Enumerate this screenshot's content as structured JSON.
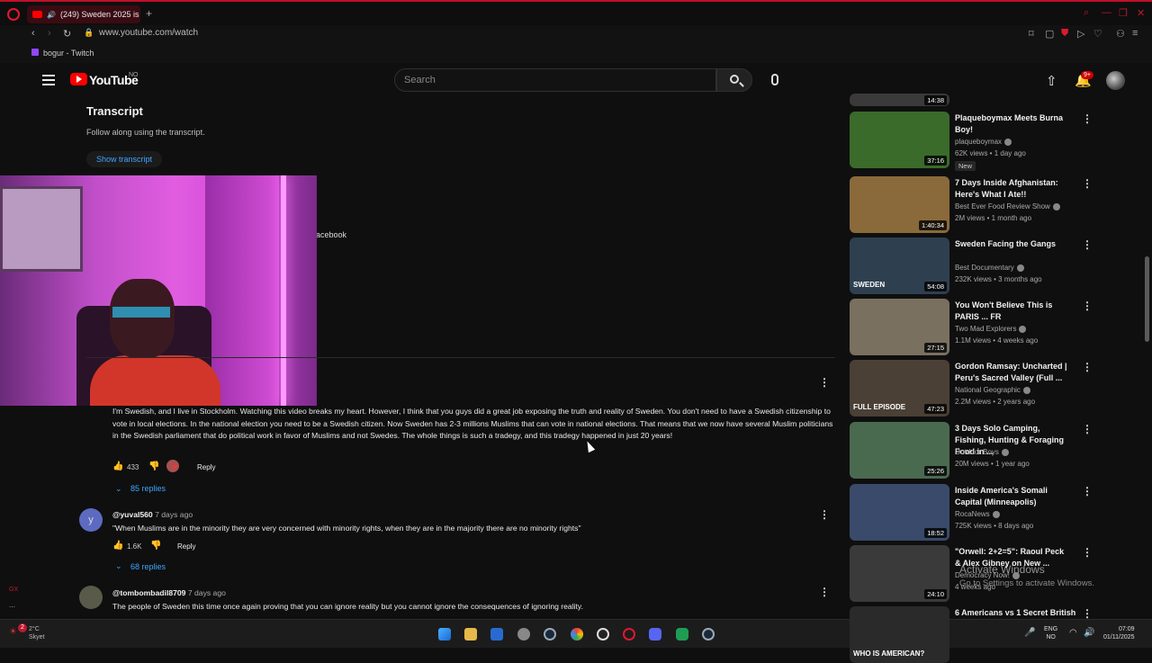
{
  "browser": {
    "tab_title": "(249) Sweden 2025 is",
    "url": "www.youtube.com/watch",
    "bookmark": "bogur - Twitch"
  },
  "youtube": {
    "wordmark": "YouTube",
    "country": "NO",
    "search_placeholder": "Search",
    "notifications": "9+"
  },
  "transcript": {
    "title": "Transcript",
    "subtitle": "Follow along using the transcript.",
    "button": "Show transcript"
  },
  "partial_text": "acebook",
  "comments": [
    {
      "text": "I'm Swedish, and I live in Stockholm. Watching this video breaks my heart. However, I think that you guys did a great job exposing the truth and reality of Sweden. You don't need to have a Swedish citizenship to vote in local elections. In the national election you need to be a Swedish citizen. Now Sweden has 2-3 millions Muslims that can vote in national elections. That means that we now have several Muslim politicians in the Swedish parliament that do political work in favor of Muslims and not Swedes. The whole things is such a tradegy, and this tradegy happened in just 20 years!",
      "likes": "433",
      "reply": "Reply",
      "replies": "85 replies"
    },
    {
      "avatar_letter": "y",
      "author": "@yuval560",
      "ago": "7 days ago",
      "text": "\"When Muslims are in the minority they are very concerned with minority rights, when they are in the majority there are no minority rights\"",
      "likes": "1.6K",
      "reply": "Reply",
      "replies": "68 replies"
    },
    {
      "author": "@tombombadil8709",
      "ago": "7 days ago",
      "text": "The people of Sweden this time once again proving that you can ignore reality but you cannot ignore the consequences of ignoring reality."
    }
  ],
  "sidebar": [
    {
      "title": "Plaqueboymax Meets Burna Boy!",
      "channel": "plaqueboymax",
      "meta": "62K views • 1 day ago",
      "badge": "New",
      "duration": "37:16",
      "color": "#3a6b2a"
    },
    {
      "title": "7 Days Inside Afghanistan: Here's What I Ate!!",
      "channel": "Best Ever Food Review Show",
      "meta": "2M views • 1 month ago",
      "duration": "1:40:34",
      "color": "#8a6a3a"
    },
    {
      "title": "Sweden Facing the Gangs",
      "channel": "Best Documentary",
      "meta": "232K views • 3 months ago",
      "duration": "54:08",
      "color": "#2e4050",
      "overlay": "SWEDEN"
    },
    {
      "title": "You Won't Believe This is PARIS ... FR",
      "channel": "Two Mad Explorers",
      "meta": "1.1M views • 4 weeks ago",
      "duration": "27:15",
      "color": "#7a7060"
    },
    {
      "title": "Gordon Ramsay: Uncharted | Peru's Sacred Valley (Full ...",
      "channel": "National Geographic",
      "meta": "2.2M views • 2 years ago",
      "duration": "47:23",
      "color": "#4a4035",
      "overlay": "FULL EPISODE"
    },
    {
      "title": "3 Days Solo Camping, Fishing, Hunting & Foraging Food in ...",
      "channel": "Outdoor Boys",
      "meta": "20M views • 1 year ago",
      "duration": "25:26",
      "color": "#4a6a50"
    },
    {
      "title": "Inside America's Somali Capital (Minneapolis)",
      "channel": "RocaNews",
      "meta": "725K views • 8 days ago",
      "duration": "18:52",
      "color": "#3a4a6a"
    },
    {
      "title": "\"Orwell: 2+2=5\": Raoul Peck & Alex Gibney on New ...",
      "channel": "Democracy Now!",
      "meta": "4 weeks ago",
      "duration": "24:10",
      "color": "#3a3a3a"
    },
    {
      "title": "6 Americans vs 1 Secret British",
      "overlay": "WHO IS AMERICAN?",
      "color": "#2a2a2a"
    }
  ],
  "sidebar_top_duration": "14:38",
  "activate": {
    "line1": "Activate Windows",
    "line2": "Go to Settings to activate Windows."
  },
  "taskbar": {
    "weather_temp": "2°C",
    "weather_desc": "Skyet",
    "lang1": "ENG",
    "lang2": "NO",
    "time": "07:09",
    "date": "01/11/2025"
  },
  "colors": {
    "accent": "#3ea6ff",
    "brand": "#ff0000",
    "opera": "#c0102a"
  }
}
